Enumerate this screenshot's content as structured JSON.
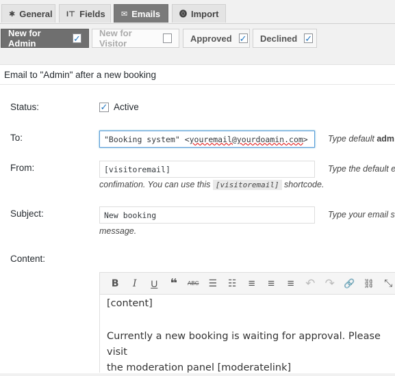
{
  "tabs": [
    {
      "icon": "✱",
      "label": "General"
    },
    {
      "icon": "I⊤",
      "label": "Fields"
    },
    {
      "icon": "✉",
      "label": "Emails"
    },
    {
      "icon": "⓿",
      "label": "Import"
    }
  ],
  "subtabs": [
    {
      "label": "New for Admin",
      "checked": true
    },
    {
      "label": "New for Visitor",
      "checked": false
    },
    {
      "label": "Approved",
      "checked": true
    },
    {
      "label": "Declined",
      "checked": true
    }
  ],
  "panel_title": "Email to \"Admin\" after a new booking",
  "status": {
    "label": "Status:",
    "checkbox_label": "Active",
    "checked": true
  },
  "to": {
    "label": "To:",
    "value_prefix": "\"Booking system\" <",
    "value_email": "youremail@yourdoamin.com",
    "value_suffix": ">",
    "hint_prefix": "Type default ",
    "hint_bold": "adm"
  },
  "from": {
    "label": "From:",
    "value": "[visitoremail]",
    "hint_line1": "Type the default e",
    "hint_line2_prefix": "confimation. You can use this ",
    "hint_code": "[visitoremail]",
    "hint_line2_suffix": " shortcode."
  },
  "subject": {
    "label": "Subject:",
    "value": "New booking",
    "hint_line1": "Type your email su",
    "hint_line2": "message."
  },
  "content": {
    "label": "Content:",
    "toolbar": [
      {
        "icon": "bold-icon",
        "glyph": "B"
      },
      {
        "icon": "italic-icon",
        "glyph": "I"
      },
      {
        "icon": "underline-icon",
        "glyph": "U"
      },
      {
        "icon": "blockquote-icon",
        "glyph": "❝"
      },
      {
        "icon": "strikethrough-icon",
        "glyph": "ABC"
      },
      {
        "icon": "bullet-list-icon",
        "glyph": "☰"
      },
      {
        "icon": "numbered-list-icon",
        "glyph": "☷"
      },
      {
        "icon": "align-left-icon",
        "glyph": "≡"
      },
      {
        "icon": "align-center-icon",
        "glyph": "≡"
      },
      {
        "icon": "align-right-icon",
        "glyph": "≡"
      },
      {
        "icon": "undo-icon",
        "glyph": "↶"
      },
      {
        "icon": "redo-icon",
        "glyph": "↷"
      },
      {
        "icon": "link-icon",
        "glyph": "🔗"
      },
      {
        "icon": "unlink-icon",
        "glyph": "⛓"
      },
      {
        "icon": "fullscreen-icon",
        "glyph": "⤡"
      }
    ],
    "body_line1": "[content]",
    "body_line2": "Currently a new booking is waiting for approval. Please visit",
    "body_line3": "the moderation panel [moderatelink]"
  },
  "colors": {
    "accent": "#1e73be",
    "active_tab": "#7a7a7a",
    "focus_border": "#5b9dd9"
  }
}
